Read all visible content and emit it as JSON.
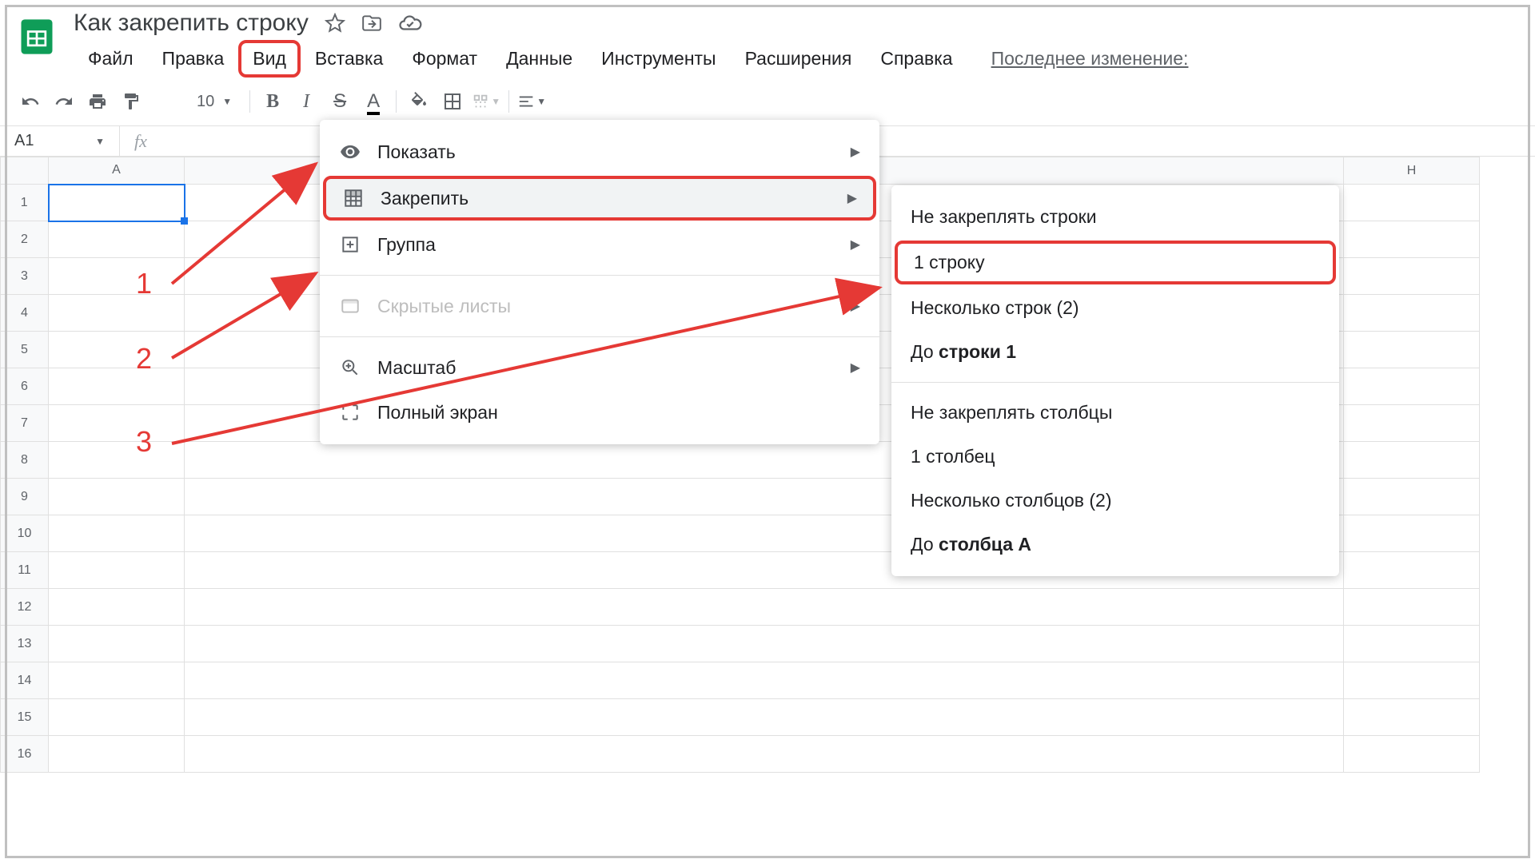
{
  "doc_title": "Как закрепить строку",
  "menubar": [
    "Файл",
    "Правка",
    "Вид",
    "Вставка",
    "Формат",
    "Данные",
    "Инструменты",
    "Расширения",
    "Справка"
  ],
  "active_menu_idx": 2,
  "last_edit": "Последнее изменение:",
  "font_size": "10",
  "cell_ref": "A1",
  "columns": [
    "A",
    "H"
  ],
  "row_count": 16,
  "view_menu": [
    {
      "label": "Показать",
      "icon": "eye-icon",
      "arrow": true
    },
    {
      "label": "Закрепить",
      "icon": "freeze-icon",
      "arrow": true,
      "highlighted": true,
      "hover": true
    },
    {
      "label": "Группа",
      "icon": "group-icon",
      "arrow": true
    },
    {
      "sep": true
    },
    {
      "label": "Скрытые листы",
      "icon": "hidden-icon",
      "arrow": true,
      "disabled": true
    },
    {
      "sep": true
    },
    {
      "label": "Масштаб",
      "icon": "zoom-icon",
      "arrow": true
    },
    {
      "label": "Полный экран",
      "icon": "fullscreen-icon"
    }
  ],
  "freeze_menu": [
    {
      "label": "Не закреплять строки"
    },
    {
      "label": "1 строку",
      "highlighted": true
    },
    {
      "label": "Несколько строк (2)"
    },
    {
      "label_html": "До <b>строки 1</b>",
      "plain": "До строки 1"
    },
    {
      "sep": true
    },
    {
      "label": "Не закреплять столбцы"
    },
    {
      "label": "1 столбец"
    },
    {
      "label": "Несколько столбцов (2)"
    },
    {
      "label_html": "До <b>столбца A</b>",
      "plain": "До столбца A"
    }
  ],
  "annotations": {
    "1": "1",
    "2": "2",
    "3": "3"
  }
}
